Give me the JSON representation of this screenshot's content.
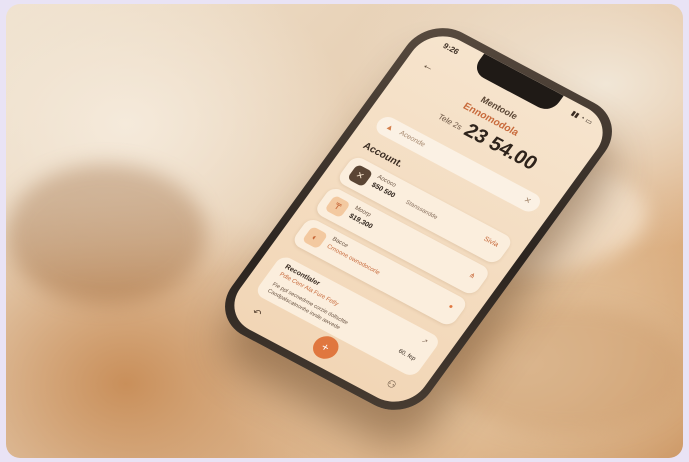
{
  "phone": {
    "status_time": "9:26",
    "status_icons": "▮▮ ◔ ▭",
    "back_icon": "back-arrow-icon",
    "header_title": "Mentoole",
    "header_subtitle": "Ennomodola",
    "balance_label": "Tele 2s",
    "balance": "23 54.00",
    "search_placeholder": "Aceonde",
    "section_title": "Account.",
    "cards": [
      {
        "icon": "✕",
        "name": "Aococo",
        "amount": "$50 500",
        "note": "Stanssandde",
        "right": "Sivla"
      },
      {
        "icon": "₸",
        "name": "Moorp",
        "amount": "$19,300",
        "note": "",
        "right": "⋔"
      },
      {
        "icon": "◐",
        "name": "Bacce",
        "amount": "",
        "note": "Crnoone ownodocorle",
        "right": "●"
      }
    ],
    "recent": {
      "title": "Recontlaler",
      "subtitle": "Pdle Cenr Ala Fure Fetly",
      "line1": "Fie ppl secnedrme corzie dollscltte",
      "line2": "Caodpalscatnonhe innile awvede",
      "amount": "60, fep",
      "arrow": "↗"
    },
    "fab_icon": "+",
    "nav_left": "↶",
    "nav_right": "⚇"
  },
  "colors": {
    "accent": "#e0773f",
    "screen_bg": "#f4dcbf",
    "fabric_light": "#efe2cf",
    "fabric_dark": "#c4854c"
  }
}
